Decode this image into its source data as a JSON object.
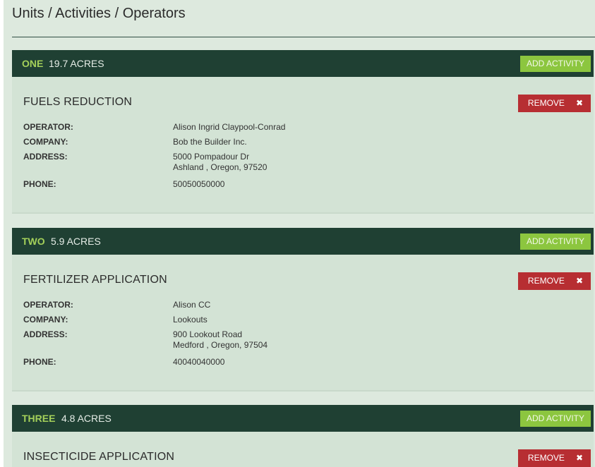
{
  "page": {
    "title": "Units / Activities / Operators"
  },
  "labels": {
    "operator": "OPERATOR:",
    "company": "COMPANY:",
    "address": "ADDRESS:",
    "phone": "PHONE:",
    "add_activity": "ADD ACTIVITY",
    "remove": "REMOVE",
    "remove_icon": "✖"
  },
  "units": [
    {
      "name": "ONE",
      "acres": "19.7 ACRES",
      "activity": "FUELS REDUCTION",
      "operator": "Alison Ingrid Claypool-Conrad",
      "company": "Bob the Builder Inc.",
      "address_line1": "5000 Pompadour Dr",
      "address_line2": "Ashland , Oregon, 97520",
      "phone": "50050050000"
    },
    {
      "name": "TWO",
      "acres": "5.9 ACRES",
      "activity": "FERTILIZER APPLICATION",
      "operator": "Alison CC",
      "company": "Lookouts",
      "address_line1": "900 Lookout Road",
      "address_line2": "Medford , Oregon, 97504",
      "phone": "40040040000"
    },
    {
      "name": "THREE",
      "acres": "4.8 ACRES",
      "activity": "INSECTICIDE APPLICATION"
    }
  ],
  "colors": {
    "header_bg": "#1f4033",
    "unit_name": "#a4d05a",
    "add_button": "#8cc63f",
    "remove_button": "#b72e32",
    "page_bg": "#dde9de"
  }
}
